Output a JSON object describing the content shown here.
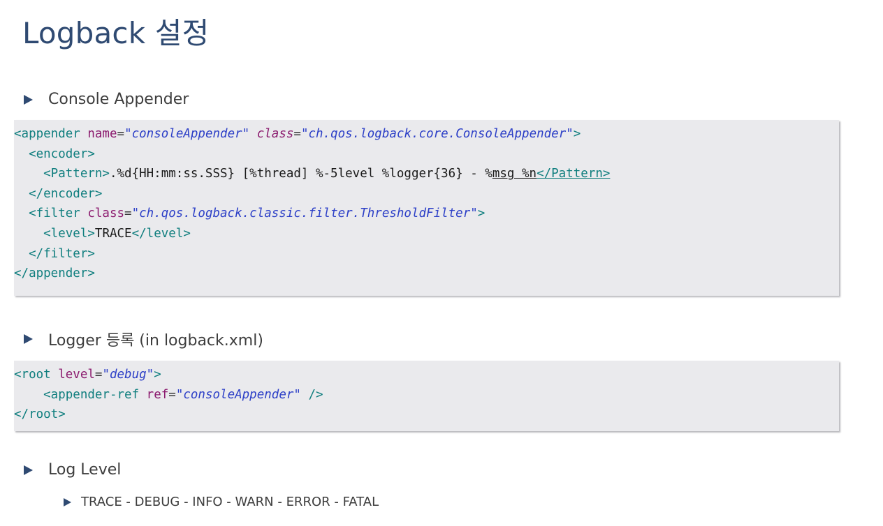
{
  "title": "Logback 설정",
  "bullets": {
    "console_appender": "Console Appender",
    "logger_register": "Logger 등록 (in logback.xml)",
    "log_level": "Log Level",
    "log_level_order": "TRACE - DEBUG - INFO - WARN - ERROR - FATAL"
  },
  "code1": {
    "l1": {
      "open": "<appender",
      "attr1": " name",
      "eq1": "=",
      "val1": "\"consoleAppender\"",
      "attr2": " class",
      "eq2": "=",
      "val2": "\"ch.qos.logback.core.ConsoleAppender\"",
      "close": ">"
    },
    "l2": {
      "tag": "  <encoder>"
    },
    "l3": {
      "tag_open": "    <Pattern>",
      "text": ".%d{HH:mm:ss.SSS} [%thread] %-5level %logger{36} - %",
      "text_ul": "msg %n",
      "tag_close": "</Pattern>"
    },
    "l4": {
      "tag": "  </encoder>"
    },
    "l5": {
      "open": "  <filter",
      "attr": " class",
      "eq": "=",
      "val": "\"ch.qos.logback.classic.filter.ThresholdFilter\"",
      "close": ">"
    },
    "l6": {
      "tag_open": "    <level>",
      "text": "TRACE",
      "tag_close": "</level>"
    },
    "l7": {
      "tag": "  </filter>"
    },
    "l8": {
      "tag": "</appender>"
    }
  },
  "code2": {
    "l1": {
      "open": "<root",
      "attr": " level",
      "eq": "=",
      "val": "\"debug\"",
      "close": ">"
    },
    "l2": {
      "open": "    <appender-ref",
      "attr": " ref",
      "eq": "=",
      "val": "\"consoleAppender\"",
      "close": " />"
    },
    "l3": {
      "tag": "</root>"
    }
  }
}
